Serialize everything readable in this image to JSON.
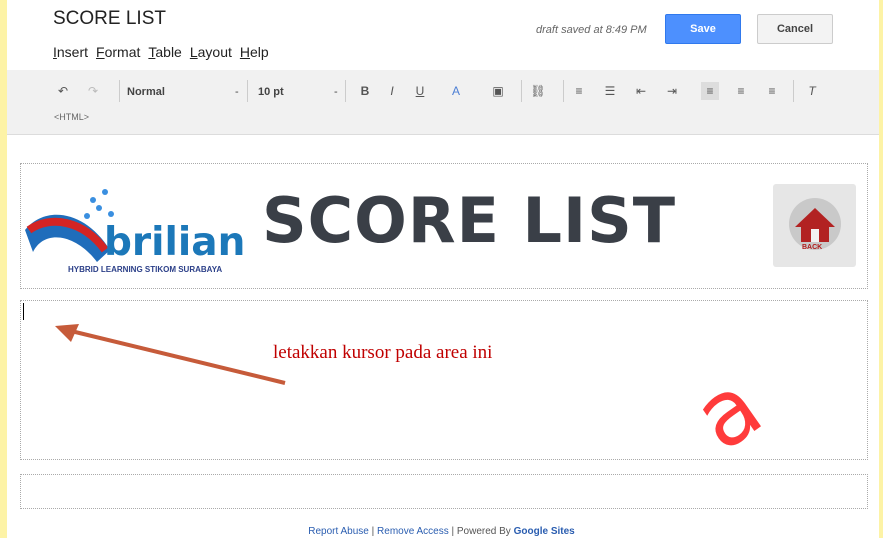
{
  "title": "SCORE LIST",
  "menu": [
    "Insert",
    "Format",
    "Table",
    "Layout",
    "Help"
  ],
  "draft_status": "draft saved at 8:49 PM",
  "buttons": {
    "save": "Save",
    "cancel": "Cancel"
  },
  "toolbar": {
    "style": "Normal",
    "font_size": "10 pt",
    "html": "<HTML>",
    "items": [
      "undo",
      "redo",
      "bold",
      "italic",
      "underline",
      "text-color",
      "background-color",
      "link",
      "numbered-list",
      "bulleted-list",
      "indent-less",
      "indent-more",
      "align-left",
      "align-center",
      "align-right",
      "clear-formatting"
    ]
  },
  "header": {
    "logo_text": "brilian",
    "logo_subtitle": "HYBRID LEARNING STIKOM SURABAYA",
    "score_title": "SCORE LIST",
    "back_label": "BACK"
  },
  "annotation_text": "letakkan kursor pada area ini",
  "footer": {
    "report_abuse": "Report Abuse",
    "remove_access": "Remove Access",
    "powered_by": "Powered By",
    "google_sites": "Google Sites"
  },
  "colors": {
    "background": "#fdf3a6",
    "accent": "#4d90fe",
    "annotation": "#c00000",
    "watermark": "#ff2626"
  },
  "watermark_text": "a"
}
